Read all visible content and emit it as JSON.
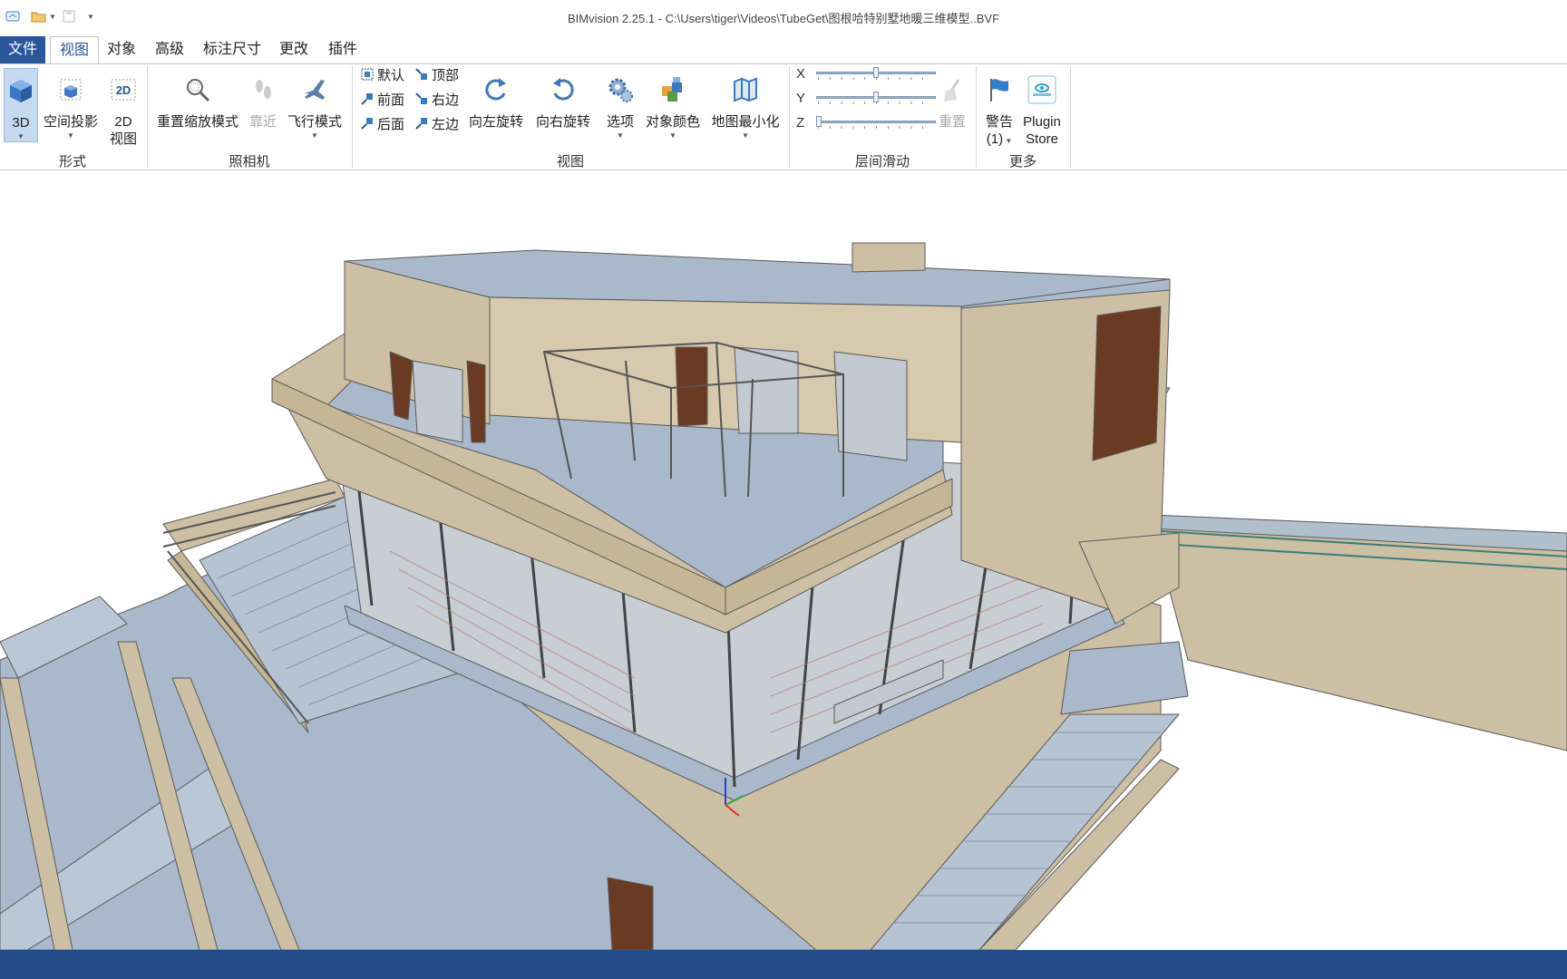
{
  "app": {
    "title": "BIMvision 2.25.1 - C:\\Users\\tiger\\Videos\\TubeGet\\图根哈特别墅地暖三维模型..BVF"
  },
  "quick_access": [
    "app-icon",
    "open-folder-icon",
    "dropdown-arrow-icon",
    "save-icon",
    "customize-arrow-icon"
  ],
  "menu": {
    "file": "文件",
    "tabs": [
      "视图",
      "对象",
      "高级",
      "标注尺寸",
      "更改",
      "插件"
    ],
    "active_index": 0
  },
  "ribbon": {
    "form": {
      "label": "形式",
      "buttons": [
        {
          "label": "3D",
          "icon": "cube-3d-icon",
          "selected": true
        },
        {
          "label": "空间投影",
          "icon": "projection-cube-icon"
        },
        {
          "label": "2D",
          "label2": "视图",
          "icon": "2d-view-icon"
        }
      ]
    },
    "camera": {
      "label": "照相机",
      "buttons": [
        {
          "label": "重置缩放模式",
          "icon": "zoom-reset-icon"
        },
        {
          "label": "靠近",
          "icon": "footsteps-icon",
          "disabled": true
        },
        {
          "label": "飞行模式",
          "icon": "airplane-icon"
        }
      ]
    },
    "view": {
      "label": "视图",
      "small_buttons": [
        "默认",
        "前面",
        "后面",
        "顶部",
        "右边",
        "左边"
      ],
      "buttons": [
        {
          "label": "向左旋转",
          "icon": "rotate-left-icon"
        },
        {
          "label": "向右旋转",
          "icon": "rotate-right-icon"
        },
        {
          "label": "选项",
          "icon": "gears-icon"
        },
        {
          "label": "对象颜色",
          "icon": "object-color-icon"
        },
        {
          "label": "地图最小化",
          "icon": "map-icon"
        }
      ]
    },
    "floor_slide": {
      "label": "层间滑动",
      "axes": [
        {
          "name": "X",
          "value": 0.5
        },
        {
          "name": "Y",
          "value": 0.5
        },
        {
          "name": "Z",
          "value": 0.0
        }
      ],
      "reset_label": "重置"
    },
    "more": {
      "label": "更多",
      "warning_label": "警告",
      "warning_count": "(1)",
      "plugin_label": "Plugin",
      "plugin_label2": "Store"
    }
  },
  "colors": {
    "accent": "#2b579a",
    "statusbar": "#234b87",
    "wall": "#cdbfa3",
    "floor": "#a9b8ca"
  }
}
